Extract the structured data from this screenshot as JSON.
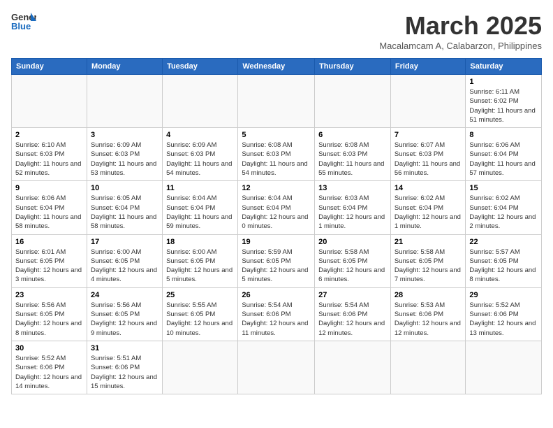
{
  "header": {
    "logo_general": "General",
    "logo_blue": "Blue",
    "month_title": "March 2025",
    "location": "Macalamcam A, Calabarzon, Philippines"
  },
  "weekdays": [
    "Sunday",
    "Monday",
    "Tuesday",
    "Wednesday",
    "Thursday",
    "Friday",
    "Saturday"
  ],
  "weeks": [
    [
      {
        "day": "",
        "info": ""
      },
      {
        "day": "",
        "info": ""
      },
      {
        "day": "",
        "info": ""
      },
      {
        "day": "",
        "info": ""
      },
      {
        "day": "",
        "info": ""
      },
      {
        "day": "",
        "info": ""
      },
      {
        "day": "1",
        "info": "Sunrise: 6:11 AM\nSunset: 6:02 PM\nDaylight: 11 hours and 51 minutes."
      }
    ],
    [
      {
        "day": "2",
        "info": "Sunrise: 6:10 AM\nSunset: 6:03 PM\nDaylight: 11 hours and 52 minutes."
      },
      {
        "day": "3",
        "info": "Sunrise: 6:09 AM\nSunset: 6:03 PM\nDaylight: 11 hours and 53 minutes."
      },
      {
        "day": "4",
        "info": "Sunrise: 6:09 AM\nSunset: 6:03 PM\nDaylight: 11 hours and 54 minutes."
      },
      {
        "day": "5",
        "info": "Sunrise: 6:08 AM\nSunset: 6:03 PM\nDaylight: 11 hours and 54 minutes."
      },
      {
        "day": "6",
        "info": "Sunrise: 6:08 AM\nSunset: 6:03 PM\nDaylight: 11 hours and 55 minutes."
      },
      {
        "day": "7",
        "info": "Sunrise: 6:07 AM\nSunset: 6:03 PM\nDaylight: 11 hours and 56 minutes."
      },
      {
        "day": "8",
        "info": "Sunrise: 6:06 AM\nSunset: 6:04 PM\nDaylight: 11 hours and 57 minutes."
      }
    ],
    [
      {
        "day": "9",
        "info": "Sunrise: 6:06 AM\nSunset: 6:04 PM\nDaylight: 11 hours and 58 minutes."
      },
      {
        "day": "10",
        "info": "Sunrise: 6:05 AM\nSunset: 6:04 PM\nDaylight: 11 hours and 58 minutes."
      },
      {
        "day": "11",
        "info": "Sunrise: 6:04 AM\nSunset: 6:04 PM\nDaylight: 11 hours and 59 minutes."
      },
      {
        "day": "12",
        "info": "Sunrise: 6:04 AM\nSunset: 6:04 PM\nDaylight: 12 hours and 0 minutes."
      },
      {
        "day": "13",
        "info": "Sunrise: 6:03 AM\nSunset: 6:04 PM\nDaylight: 12 hours and 1 minute."
      },
      {
        "day": "14",
        "info": "Sunrise: 6:02 AM\nSunset: 6:04 PM\nDaylight: 12 hours and 1 minute."
      },
      {
        "day": "15",
        "info": "Sunrise: 6:02 AM\nSunset: 6:04 PM\nDaylight: 12 hours and 2 minutes."
      }
    ],
    [
      {
        "day": "16",
        "info": "Sunrise: 6:01 AM\nSunset: 6:05 PM\nDaylight: 12 hours and 3 minutes."
      },
      {
        "day": "17",
        "info": "Sunrise: 6:00 AM\nSunset: 6:05 PM\nDaylight: 12 hours and 4 minutes."
      },
      {
        "day": "18",
        "info": "Sunrise: 6:00 AM\nSunset: 6:05 PM\nDaylight: 12 hours and 5 minutes."
      },
      {
        "day": "19",
        "info": "Sunrise: 5:59 AM\nSunset: 6:05 PM\nDaylight: 12 hours and 5 minutes."
      },
      {
        "day": "20",
        "info": "Sunrise: 5:58 AM\nSunset: 6:05 PM\nDaylight: 12 hours and 6 minutes."
      },
      {
        "day": "21",
        "info": "Sunrise: 5:58 AM\nSunset: 6:05 PM\nDaylight: 12 hours and 7 minutes."
      },
      {
        "day": "22",
        "info": "Sunrise: 5:57 AM\nSunset: 6:05 PM\nDaylight: 12 hours and 8 minutes."
      }
    ],
    [
      {
        "day": "23",
        "info": "Sunrise: 5:56 AM\nSunset: 6:05 PM\nDaylight: 12 hours and 8 minutes."
      },
      {
        "day": "24",
        "info": "Sunrise: 5:56 AM\nSunset: 6:05 PM\nDaylight: 12 hours and 9 minutes."
      },
      {
        "day": "25",
        "info": "Sunrise: 5:55 AM\nSunset: 6:05 PM\nDaylight: 12 hours and 10 minutes."
      },
      {
        "day": "26",
        "info": "Sunrise: 5:54 AM\nSunset: 6:06 PM\nDaylight: 12 hours and 11 minutes."
      },
      {
        "day": "27",
        "info": "Sunrise: 5:54 AM\nSunset: 6:06 PM\nDaylight: 12 hours and 12 minutes."
      },
      {
        "day": "28",
        "info": "Sunrise: 5:53 AM\nSunset: 6:06 PM\nDaylight: 12 hours and 12 minutes."
      },
      {
        "day": "29",
        "info": "Sunrise: 5:52 AM\nSunset: 6:06 PM\nDaylight: 12 hours and 13 minutes."
      }
    ],
    [
      {
        "day": "30",
        "info": "Sunrise: 5:52 AM\nSunset: 6:06 PM\nDaylight: 12 hours and 14 minutes."
      },
      {
        "day": "31",
        "info": "Sunrise: 5:51 AM\nSunset: 6:06 PM\nDaylight: 12 hours and 15 minutes."
      },
      {
        "day": "",
        "info": ""
      },
      {
        "day": "",
        "info": ""
      },
      {
        "day": "",
        "info": ""
      },
      {
        "day": "",
        "info": ""
      },
      {
        "day": "",
        "info": ""
      }
    ]
  ]
}
